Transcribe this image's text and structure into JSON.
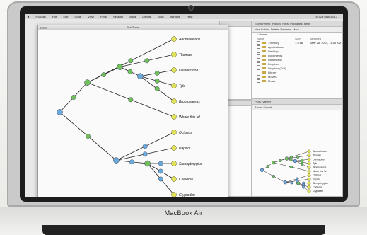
{
  "device": {
    "brand_label": "MacBook Air"
  },
  "menubar": {
    "items": [
      "RStudio",
      "File",
      "Edit",
      "Code",
      "View",
      "Plots",
      "Session",
      "Build",
      "Debug",
      "Tools",
      "Window",
      "Help"
    ],
    "status": "Thu 28 May 12:17"
  },
  "plot_window": {
    "title": "Plot Zoom"
  },
  "environment_pane": {
    "tabs": [
      "Environment",
      "History",
      "Files",
      "Packages",
      "Help"
    ],
    "actions": [
      "New Folder",
      "Delete",
      "Rename",
      "More"
    ],
    "path": "Home",
    "column_headers": [
      "Name",
      "Size",
      "Modified"
    ],
    "files": [
      {
        "name": ".Rhistory",
        "size": "1.5 kB",
        "modified": "May 28, 2015, 11:16 AM"
      },
      {
        "name": "Applications",
        "size": "",
        "modified": ""
      },
      {
        "name": "Desktop",
        "size": "",
        "modified": ""
      },
      {
        "name": "Documents",
        "size": "",
        "modified": ""
      },
      {
        "name": "Downloads",
        "size": "",
        "modified": ""
      },
      {
        "name": "Dropbox",
        "size": "",
        "modified": ""
      },
      {
        "name": "Dropbox (DIA)",
        "size": "",
        "modified": ""
      },
      {
        "name": "Library",
        "size": "",
        "modified": ""
      },
      {
        "name": "Movies",
        "size": "",
        "modified": ""
      },
      {
        "name": "Music",
        "size": "",
        "modified": ""
      }
    ]
  },
  "plots_pane": {
    "tabs": [
      "Plots",
      "Viewer"
    ],
    "actions": [
      "Zoom",
      "Export"
    ]
  },
  "tree": {
    "leaves": [
      "Anomalocaris",
      "Thomas",
      "Deinotrodon",
      "Tylo",
      "Brontosaurus",
      "Whale this lol",
      "Octopus",
      "Papilio",
      "Stenopterygius",
      "Chelonia",
      "Glyptodon"
    ],
    "mini_leaves": [
      "Anomalocaris",
      "Thomas",
      "Deinotrodon",
      "Tylo",
      "Brontosaurus",
      "Whale this lol",
      "Octopus",
      "Papilio",
      "Stenopterygius",
      "Chelonia",
      "Glyptodon"
    ]
  },
  "colors": {
    "node_green": "#6fbf5a",
    "node_blue": "#6aa9d8",
    "node_yellow": "#e3e35a",
    "screen_bg": "#5b6a78"
  }
}
